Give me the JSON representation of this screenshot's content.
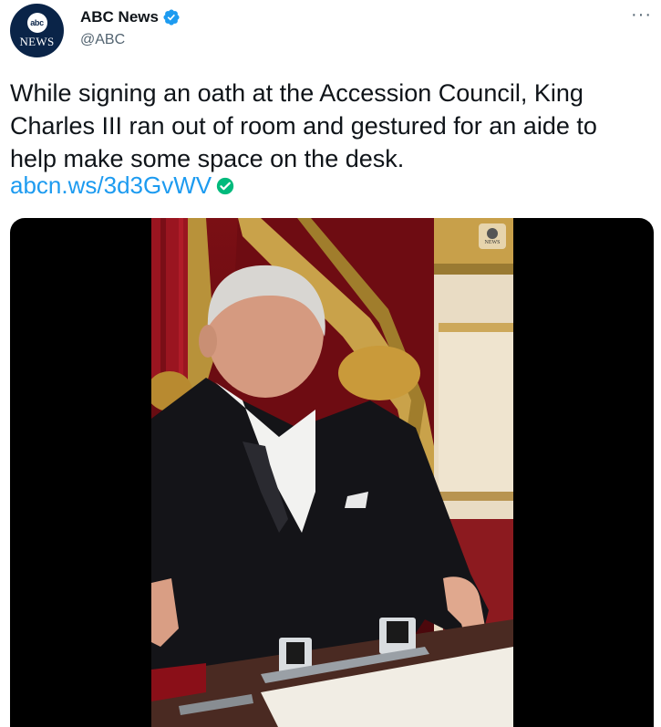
{
  "account": {
    "display_name": "ABC News",
    "handle": "@ABC",
    "avatar_logo_text": "abc",
    "avatar_sub_text": "NEWS",
    "verified": true
  },
  "menu": {
    "more_label": "···"
  },
  "tweet": {
    "text": "While signing an oath at the Accession Council, King Charles III ran out of room and gestured for an aide to help make some space on the desk.",
    "link_text": "abcn.ws/3d3GvWV"
  },
  "media": {
    "type": "video",
    "watermark_text": "NEWS"
  },
  "colors": {
    "link": "#1d9bf0",
    "verified": "#1d9bf0",
    "link_check": "#00ba7c",
    "secondary_text": "#536471",
    "avatar_bg": "#0a2448"
  }
}
